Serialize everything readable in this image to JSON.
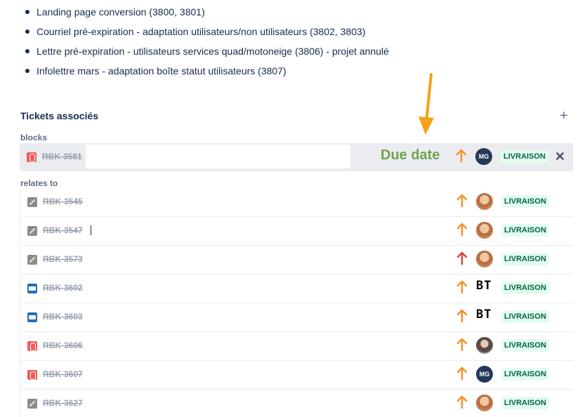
{
  "bullets": [
    "Landing page conversion (3800, 3801)",
    "Courriel pré-expiration - adaptation utilisateurs/non utilisateurs (3802, 3803)",
    "Lettre pré-expiration - utilisateurs services quad/motoneige (3806) - projet annulé",
    "Infolettre mars - adaptation boîte statut utilisateurs (3807)"
  ],
  "linked": {
    "title": "Tickets associés",
    "add_icon": "+",
    "blocks_label": "blocks",
    "relates_label": "relates to",
    "close_icon": "✕",
    "annotation": "Due date"
  },
  "blocks": [
    {
      "key": "RBK-3581",
      "type": "bug",
      "priority": "medium",
      "assignee": "MG",
      "avatar": "initials",
      "status": "LIVRAISON"
    }
  ],
  "relates": [
    {
      "key": "RBK-3545",
      "type": "story",
      "priority": "medium",
      "avatar": "photo",
      "status": "LIVRAISON"
    },
    {
      "key": "RBK-3547",
      "type": "story",
      "priority": "medium",
      "avatar": "photo",
      "status": "LIVRAISON"
    },
    {
      "key": "RBK-3573",
      "type": "story",
      "priority": "high",
      "avatar": "photo",
      "status": "LIVRAISON"
    },
    {
      "key": "RBK-3602",
      "type": "bus",
      "priority": "medium",
      "assignee": "BT",
      "avatar": "text",
      "status": "LIVRAISON"
    },
    {
      "key": "RBK-3603",
      "type": "bus",
      "priority": "medium",
      "assignee": "BT",
      "avatar": "text",
      "status": "LIVRAISON"
    },
    {
      "key": "RBK-3606",
      "type": "bug",
      "priority": "medium",
      "avatar": "photo2",
      "status": "LIVRAISON"
    },
    {
      "key": "RBK-3607",
      "type": "bug",
      "priority": "medium",
      "assignee": "MG",
      "avatar": "initials",
      "status": "LIVRAISON"
    },
    {
      "key": "RBK-3627",
      "type": "story",
      "priority": "medium",
      "avatar": "photo",
      "status": "LIVRAISON"
    }
  ],
  "colors": {
    "priority_medium": "#f6902b",
    "priority_high": "#d04437",
    "annotation_arrow": "#f6a01a",
    "due_date_text": "#6fa44b"
  }
}
